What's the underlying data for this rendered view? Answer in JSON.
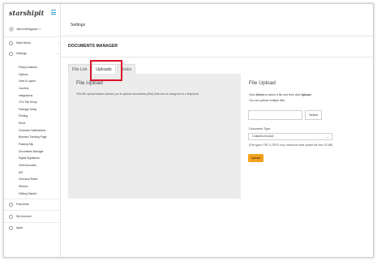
{
  "sidebar": {
    "logo": "starshipit",
    "user": "Jaelo Keithnjguard",
    "main_menu": "Main Menu",
    "settings": "Settings",
    "items": [
      "Pickup Address",
      "Options",
      "View & Layout",
      "Couriers",
      "Integrations",
      "CSV File Setup",
      "Package Setup",
      "Printing",
      "Rules",
      "Customer Notifications",
      "Branded Tracking Page",
      "Packing Slip",
      "Documents Manager",
      "Digital Signatures",
      "Child Accounts",
      "API",
      "Checkout Rates",
      "Returns",
      "Getting Started"
    ],
    "franchise": "Franchise",
    "my_account": "My Account",
    "apps": "Apps"
  },
  "header": {
    "title": "Settings"
  },
  "main": {
    "section_title": "DOCUMENTS MANAGER",
    "tabs": [
      "File List",
      "Uploads",
      "Rules"
    ],
    "active_tab": "Uploads",
    "left_panel": {
      "title": "File Upload",
      "text": "This file upload feature allows you to upload documents (files) that can be assigned to a shipment"
    },
    "right_panel": {
      "title": "File Upload",
      "line1_a": "Click ",
      "line1_b": "Select",
      "line1_c": " to select a file and then click ",
      "line1_d": "Upload",
      "line1_e": ".",
      "line2": "You can upload multiple files.",
      "select_button": "Select",
      "doc_type_label": "Document Type",
      "doc_type_value": "Customs Invoice",
      "file_types": "(File types: PDF & JPEG only. Maximum total upload file size 10 MB)",
      "upload_button": "Upload"
    }
  },
  "colors": {
    "accent": "#f4a21b",
    "highlight": "#d9142b",
    "brand": "#2f9fd0"
  }
}
